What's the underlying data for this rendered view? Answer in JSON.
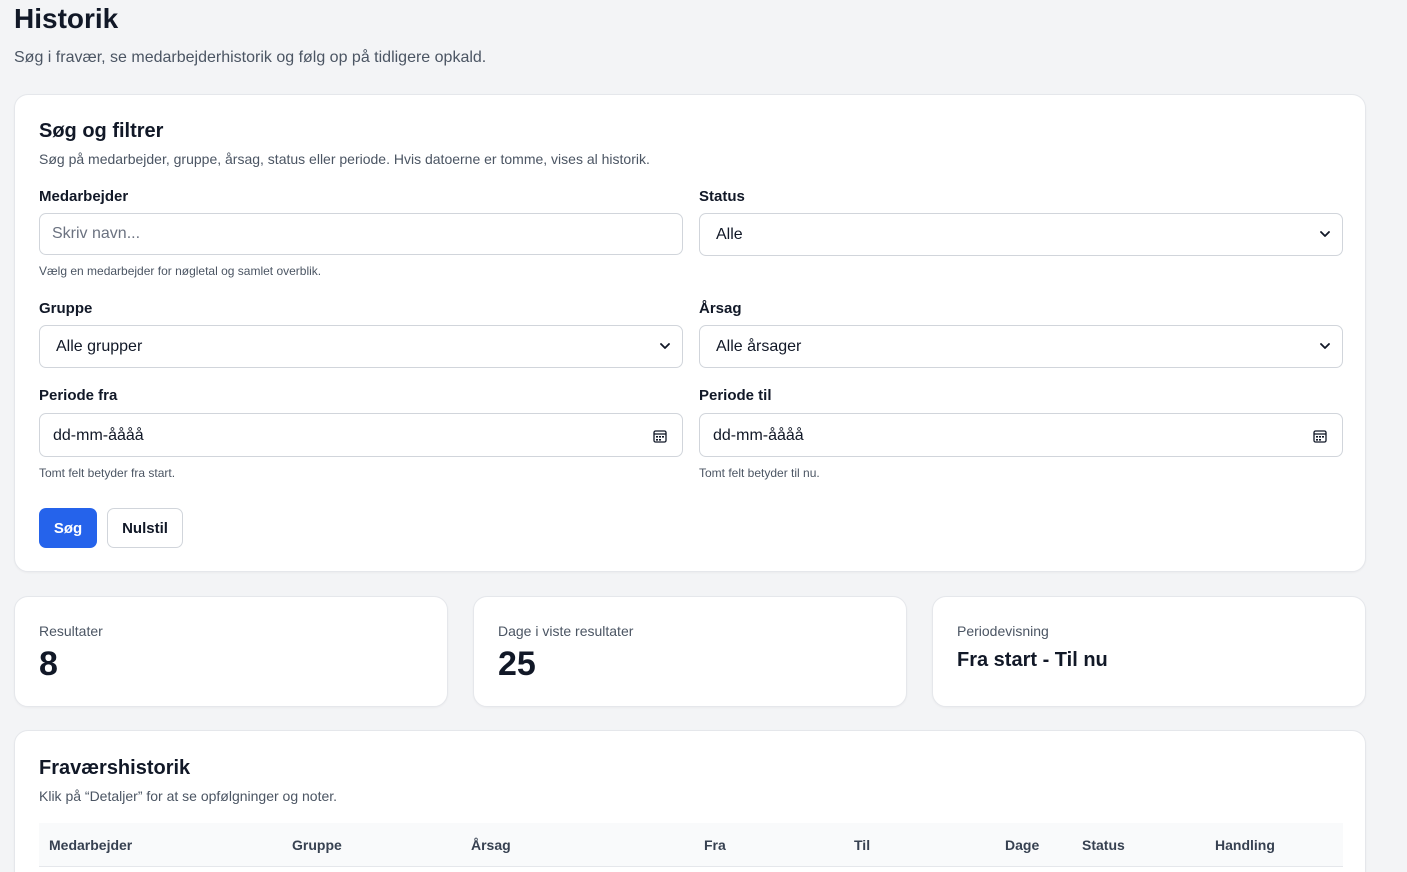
{
  "page": {
    "title": "Historik",
    "subtitle": "Søg i fravær, se medarbejderhistorik og følg op på tidligere opkald."
  },
  "filters": {
    "title": "Søg og filtrer",
    "description": "Søg på medarbejder, gruppe, årsag, status eller periode. Hvis datoerne er tomme, vises al historik.",
    "employee": {
      "label": "Medarbejder",
      "placeholder": "Skriv navn...",
      "value": "",
      "help": "Vælg en medarbejder for nøgletal og samlet overblik."
    },
    "status": {
      "label": "Status",
      "selected": "Alle"
    },
    "group": {
      "label": "Gruppe",
      "selected": "Alle grupper"
    },
    "reason": {
      "label": "Årsag",
      "selected": "Alle årsager"
    },
    "period_from": {
      "label": "Periode fra",
      "value": "dd-mm-åååå",
      "help": "Tomt felt betyder fra start."
    },
    "period_to": {
      "label": "Periode til",
      "value": "dd-mm-åååå",
      "help": "Tomt felt betyder til nu."
    },
    "search_label": "Søg",
    "reset_label": "Nulstil"
  },
  "stats": {
    "results": {
      "label": "Resultater",
      "value": "8"
    },
    "days": {
      "label": "Dage i viste resultater",
      "value": "25"
    },
    "period": {
      "label": "Periodevisning",
      "value": "Fra start - Til nu"
    }
  },
  "history": {
    "title": "Fraværshistorik",
    "description": "Klik på “Detaljer” for at se opfølgninger og noter.",
    "columns": [
      "Medarbejder",
      "Gruppe",
      "Årsag",
      "Fra",
      "Til",
      "Dage",
      "Status",
      "Handling"
    ]
  },
  "colors": {
    "primary": "#2563eb",
    "background": "#f3f4f6",
    "card": "#ffffff",
    "border": "#d1d5db"
  }
}
